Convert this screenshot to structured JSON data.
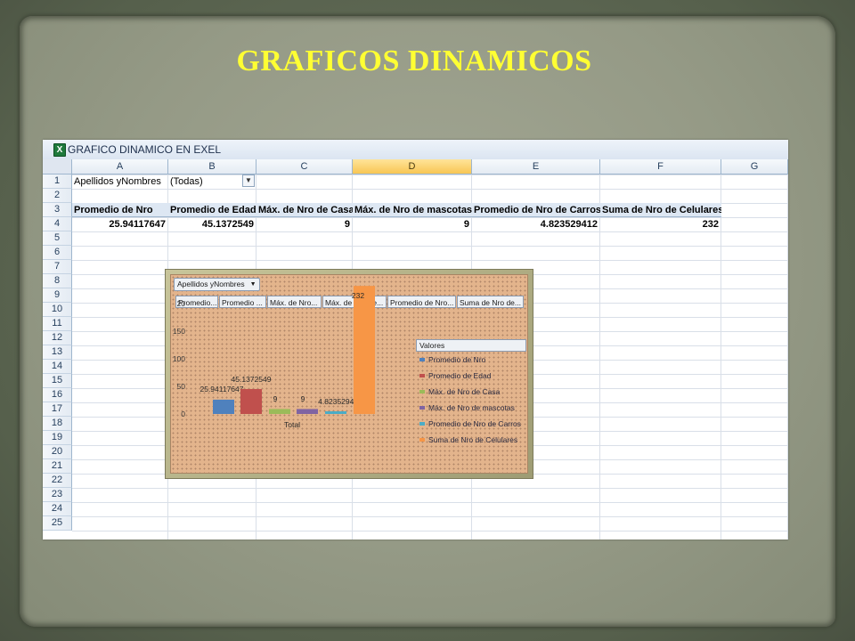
{
  "slide": {
    "title": "GRAFICOS DINAMICOS"
  },
  "window": {
    "title": "GRAFICO  DINAMICO EN EXEL",
    "icon": "excel-icon"
  },
  "sheet": {
    "columns": [
      {
        "label": "A",
        "w": 108
      },
      {
        "label": "B",
        "w": 99
      },
      {
        "label": "C",
        "w": 108
      },
      {
        "label": "D",
        "w": 134
      },
      {
        "label": "E",
        "w": 144
      },
      {
        "label": "F",
        "w": 136
      },
      {
        "label": "G",
        "w": 75
      }
    ],
    "selected_column": "D",
    "rows": [
      "1",
      "2",
      "3",
      "4",
      "5",
      "6",
      "7",
      "8",
      "9",
      "10",
      "11",
      "12",
      "13",
      "14",
      "15",
      "16",
      "17",
      "18",
      "19",
      "20",
      "21",
      "22",
      "23",
      "24",
      "25"
    ],
    "filter": {
      "label": "Apellidos yNombres",
      "value": "(Todas)"
    },
    "headers": [
      "Promedio de Nro",
      "Promedio de Edad",
      "Máx. de Nro de Casa",
      "Máx. de Nro de mascotas",
      "Promedio de Nro de Carros",
      "Suma de Nro de Celulares"
    ],
    "values": [
      "25.94117647",
      "45.1372549",
      "9",
      "9",
      "4.823529412",
      "232"
    ]
  },
  "chart": {
    "filter_button": "Apellidos yNombres",
    "field_buttons": [
      "Promedio...",
      "Promedio ...",
      "Máx. de Nro...",
      "Máx. de Nro de...",
      "Promedio de Nro...",
      "Suma de Nro de..."
    ],
    "legend_title": "Valores"
  },
  "chart_data": {
    "type": "bar",
    "categories": [
      "Total"
    ],
    "series": [
      {
        "name": "Promedio de Nro",
        "values": [
          25.94117647
        ],
        "color": "#4f81bd",
        "label": "25.94117647"
      },
      {
        "name": "Promedio de Edad",
        "values": [
          45.1372549
        ],
        "color": "#c0504d",
        "label": "45.1372549"
      },
      {
        "name": "Máx. de Nro de Casa",
        "values": [
          9
        ],
        "color": "#9bbb59",
        "label": "9"
      },
      {
        "name": "Máx. de Nro de mascotas",
        "values": [
          9
        ],
        "color": "#8064a2",
        "label": "9"
      },
      {
        "name": "Promedio de Nro de Carros",
        "values": [
          4.823529412
        ],
        "color": "#4bacc6",
        "label": "4.823529412"
      },
      {
        "name": "Suma de Nro de Celulares",
        "values": [
          232
        ],
        "color": "#f79646",
        "label": "232"
      }
    ],
    "yticks": [
      "0",
      "50",
      "100",
      "150",
      "20"
    ],
    "ylim": [
      0,
      200
    ],
    "xlabel": "Total",
    "legend": "right"
  }
}
